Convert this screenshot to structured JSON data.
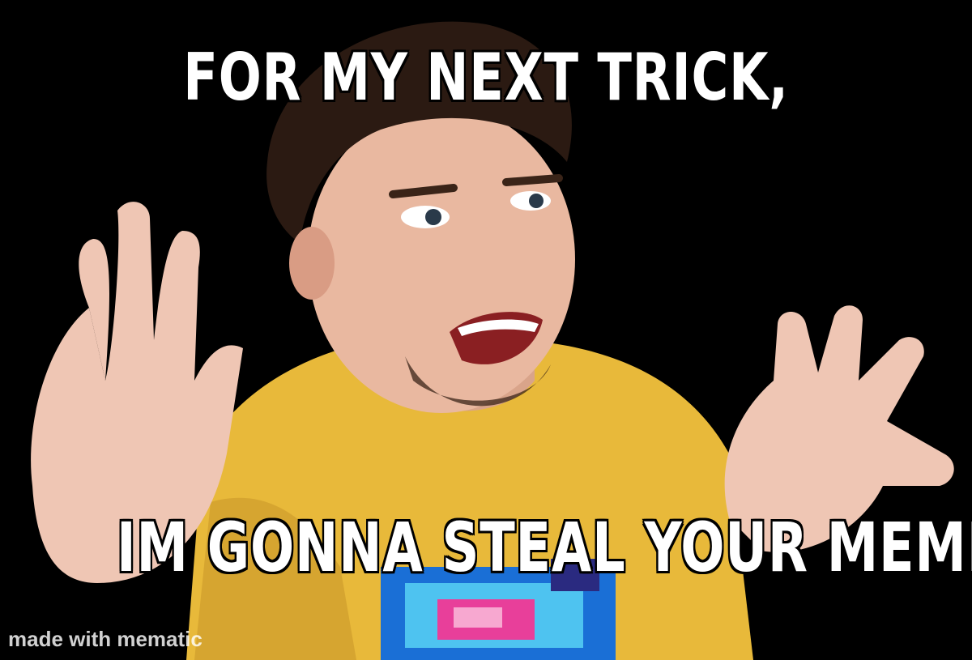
{
  "meme": {
    "top_caption": "FOR MY NEXT TRICK,",
    "bottom_caption": "IM GONNA STEAL YOUR MEME!",
    "watermark": "made with mematic"
  },
  "colors": {
    "background": "#000000",
    "shirt": "#e8b93a",
    "skin": "#e9b8a0",
    "hair": "#2b1a12",
    "caption_fill": "#ffffff",
    "caption_outline": "#000000"
  }
}
